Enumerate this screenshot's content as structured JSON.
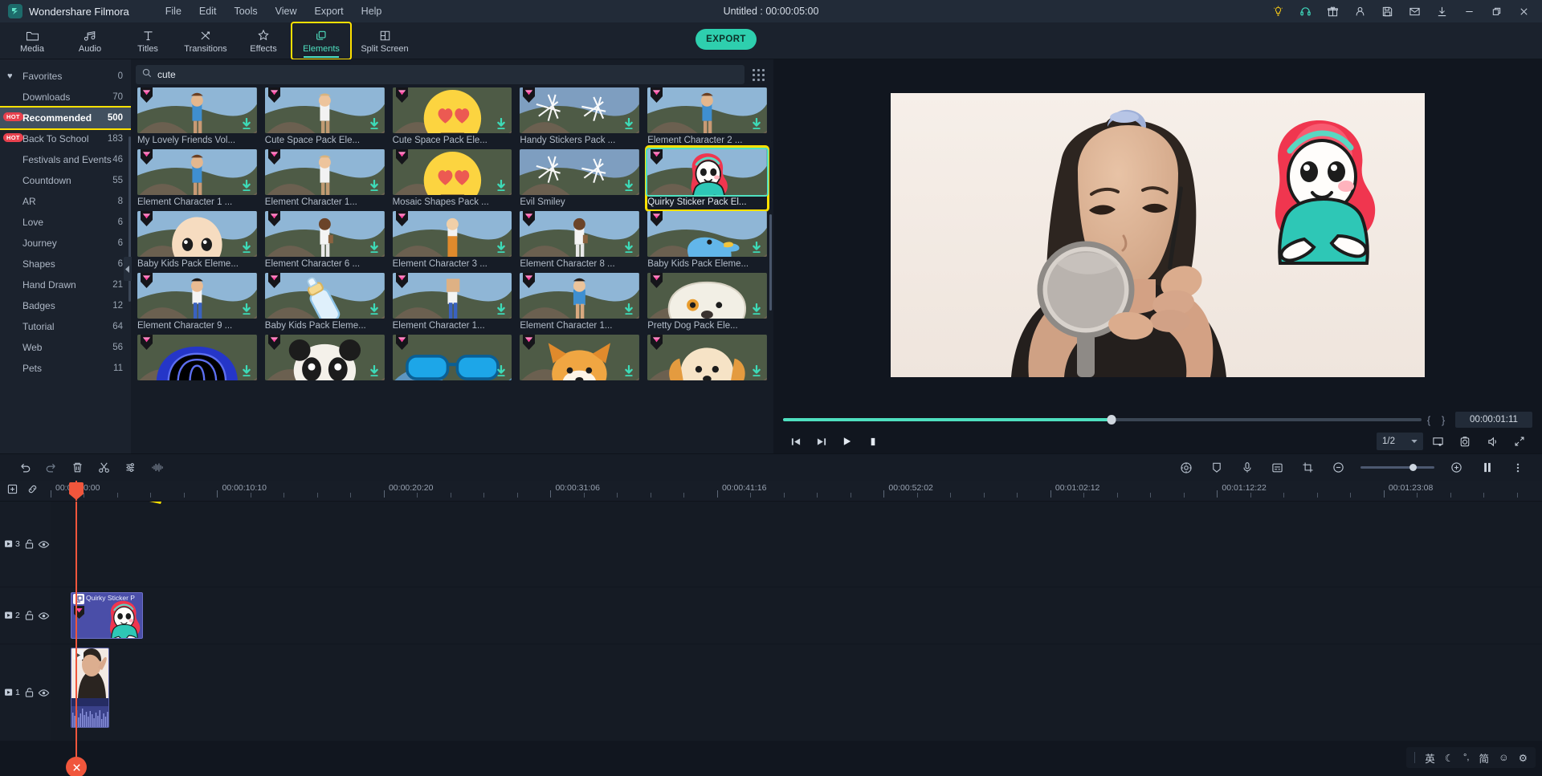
{
  "titlebar": {
    "app_name": "Wondershare Filmora",
    "logo_icon": "filmora-logo-icon",
    "menus": [
      "File",
      "Edit",
      "Tools",
      "View",
      "Export",
      "Help"
    ],
    "document_title": "Untitled : 00:00:05:00",
    "icons": [
      "lightbulb-tip-icon",
      "headset-support-icon",
      "gift-icon",
      "account-icon",
      "save-icon",
      "mail-icon",
      "download-icon",
      "minimize-icon",
      "restore-icon",
      "close-icon"
    ]
  },
  "navbar": {
    "tabs": [
      {
        "label": "Media",
        "icon": "folder-icon"
      },
      {
        "label": "Audio",
        "icon": "music-note-icon"
      },
      {
        "label": "Titles",
        "icon": "text-t-icon"
      },
      {
        "label": "Transitions",
        "icon": "transitions-arrows-icon"
      },
      {
        "label": "Effects",
        "icon": "magic-star-icon"
      },
      {
        "label": "Elements",
        "icon": "layers-icon"
      },
      {
        "label": "Split Screen",
        "icon": "split-screen-icon"
      }
    ],
    "selected_tab": "Elements",
    "highlighted_tab": "Elements",
    "export_label": "EXPORT",
    "accent_color": "#4fe0c0",
    "highlight_color": "#ffe100"
  },
  "sidebar": {
    "items": [
      {
        "label": "Favorites",
        "count": "0",
        "badge": "",
        "icon": "heart-icon"
      },
      {
        "label": "Downloads",
        "count": "70",
        "badge": ""
      },
      {
        "label": "Recommended",
        "count": "500",
        "badge": "HOT",
        "active": true
      },
      {
        "label": "Back To School",
        "count": "183",
        "badge": "HOT"
      },
      {
        "label": "Festivals and Events",
        "count": "46",
        "badge": ""
      },
      {
        "label": "Countdown",
        "count": "55",
        "badge": ""
      },
      {
        "label": "AR",
        "count": "8",
        "badge": ""
      },
      {
        "label": "Love",
        "count": "6",
        "badge": ""
      },
      {
        "label": "Journey",
        "count": "6",
        "badge": ""
      },
      {
        "label": "Shapes",
        "count": "6",
        "badge": ""
      },
      {
        "label": "Hand Drawn",
        "count": "21",
        "badge": ""
      },
      {
        "label": "Badges",
        "count": "12",
        "badge": ""
      },
      {
        "label": "Tutorial",
        "count": "64",
        "badge": ""
      },
      {
        "label": "Web",
        "count": "56",
        "badge": ""
      },
      {
        "label": "Pets",
        "count": "11",
        "badge": ""
      }
    ],
    "collapse_icon": "collapse-left-arrow-icon"
  },
  "search": {
    "value": "cute",
    "placeholder": "Search",
    "icon": "search-icon",
    "grid_view_icon": "grid-view-icon"
  },
  "elements_grid": {
    "rows": [
      [
        {
          "label": "My Lovely Friends Vol...",
          "art": "char-blue",
          "premium": true,
          "downloadable": true
        },
        {
          "label": "Cute Space Pack Ele...",
          "art": "char-white",
          "premium": true,
          "downloadable": true
        },
        {
          "label": "Cute Space Pack Ele...",
          "art": "smiley-hearts",
          "premium": true,
          "downloadable": true
        },
        {
          "label": "Handy Stickers Pack ...",
          "art": "sparkle-stars",
          "premium": true,
          "downloadable": true
        },
        {
          "label": "Element Character 2 ...",
          "art": "char-blue",
          "premium": true,
          "downloadable": true
        }
      ],
      [
        {
          "label": "Element Character 1 ...",
          "art": "char-blue",
          "premium": true,
          "downloadable": true
        },
        {
          "label": "Element Character 1...",
          "art": "char-white",
          "premium": true,
          "downloadable": true
        },
        {
          "label": "Mosaic Shapes Pack ...",
          "art": "smiley-hearts",
          "premium": true,
          "downloadable": true
        },
        {
          "label": "Evil Smiley",
          "art": "sparkle-stars",
          "premium": false,
          "downloadable": true
        },
        {
          "label": "Quirky Sticker Pack El...",
          "art": "girl-sticker",
          "premium": true,
          "downloadable": false,
          "selected": true
        }
      ],
      [
        {
          "label": "Baby Kids Pack Eleme...",
          "art": "baby-head",
          "premium": true,
          "downloadable": true
        },
        {
          "label": "Element Character 6 ...",
          "art": "char-dark-white",
          "premium": true,
          "downloadable": true
        },
        {
          "label": "Element Character 3 ...",
          "art": "char-orange",
          "premium": true,
          "downloadable": true
        },
        {
          "label": "Element Character 8 ...",
          "art": "char-dark-white",
          "premium": true,
          "downloadable": true
        },
        {
          "label": "Baby Kids Pack Eleme...",
          "art": "blue-duck",
          "premium": true,
          "downloadable": true
        }
      ],
      [
        {
          "label": "Element Character 9 ...",
          "art": "char-blue-jeans",
          "premium": true,
          "downloadable": true
        },
        {
          "label": "Baby Kids Pack Eleme...",
          "art": "baby-bottle",
          "premium": true,
          "downloadable": true
        },
        {
          "label": "Element Character 1...",
          "art": "char-box-head",
          "premium": true,
          "downloadable": true
        },
        {
          "label": "Element Character 1...",
          "art": "char-blue-tee",
          "premium": true,
          "downloadable": true
        },
        {
          "label": "Pretty Dog Pack Ele...",
          "art": "dog-face",
          "premium": true,
          "downloadable": true
        }
      ],
      [
        {
          "label": "",
          "art": "blue-helmet",
          "premium": true,
          "downloadable": true
        },
        {
          "label": "",
          "art": "panda-face",
          "premium": true,
          "downloadable": true
        },
        {
          "label": "",
          "art": "blue-glasses",
          "premium": true,
          "downloadable": true
        },
        {
          "label": "",
          "art": "corgi-dog",
          "premium": true,
          "downloadable": true
        },
        {
          "label": "",
          "art": "puppy-dog",
          "premium": true,
          "downloadable": true
        }
      ]
    ]
  },
  "preview": {
    "progress_percent": "51.5",
    "mark_in_icon": "mark-in-brace",
    "mark_out_icon": "mark-out-brace",
    "timecode": "00:00:01:11",
    "controls": [
      {
        "icon": "prev-frame-icon"
      },
      {
        "icon": "next-frame-icon"
      },
      {
        "icon": "play-icon"
      },
      {
        "icon": "stop-icon"
      }
    ],
    "quality": "1/2",
    "quality_caret": "chevron-down-icon",
    "right_icons": [
      "snapshot-screen-icon",
      "camera-icon",
      "volume-icon",
      "fullscreen-icon"
    ]
  },
  "timeline_toolbar": {
    "left_icons": [
      "undo-icon",
      "redo-icon",
      "delete-icon",
      "split-scissors-icon",
      "adjust-sliders-icon",
      "audio-waveform-icon"
    ],
    "right_icons": [
      "color-match-icon",
      "marker-icon",
      "voiceover-mic-icon",
      "subtitle-icon",
      "crop-icon"
    ],
    "zoom_out_icon": "zoom-out-icon",
    "zoom_in_icon": "zoom-in-icon",
    "zoom_position_percent": "66",
    "render_icon": "render-preview-icon",
    "more_icon": "more-options-icon"
  },
  "ruler": {
    "add_track_icon": "add-track-icon",
    "link_icon": "link-clips-icon",
    "labels": [
      "00:00:00:00",
      "00:00:10:10",
      "00:00:20:20",
      "00:00:31:06",
      "00:00:41:16",
      "00:00:52:02",
      "00:01:02:12",
      "00:01:12:22",
      "00:01:23:08"
    ]
  },
  "tracks": [
    {
      "number": "3",
      "lock_icon": "unlock-icon",
      "eye_icon": "eye-visible-icon",
      "clips": []
    },
    {
      "number": "2",
      "lock_icon": "unlock-icon",
      "eye_icon": "eye-visible-icon",
      "clips": [
        {
          "title": "Quirky Sticker P",
          "type": "element"
        }
      ]
    },
    {
      "number": "1",
      "lock_icon": "unlock-icon",
      "eye_icon": "eye-visible-icon",
      "clips": [
        {
          "title": "",
          "type": "video"
        }
      ]
    }
  ],
  "annotation": {
    "arrow_color": "#ffe100",
    "arrow_name": "yellow-pointer-arrow"
  },
  "ime": {
    "lang": "英",
    "moon_icon": "moon-icon",
    "punct_icon": "punctuation-icon",
    "mode": "简",
    "emoji_icon": "emoji-icon",
    "settings_icon": "gear-icon"
  }
}
